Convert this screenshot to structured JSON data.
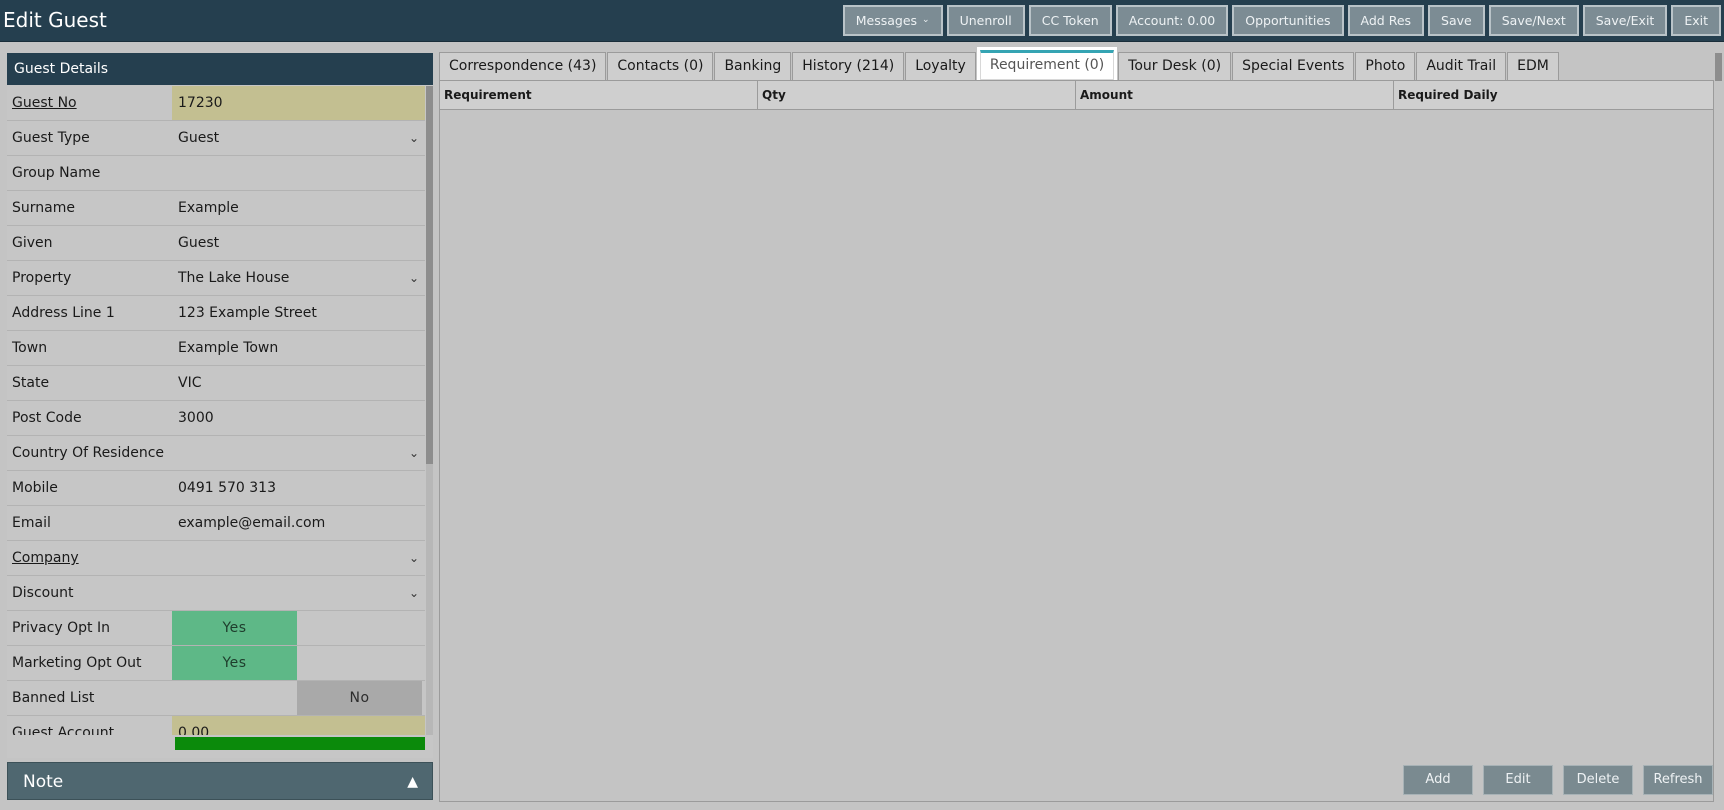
{
  "header": {
    "title": "Edit Guest",
    "toolbar": [
      {
        "name": "messages-button",
        "label": "Messages",
        "dropdown": true
      },
      {
        "name": "unenroll-button",
        "label": "Unenroll"
      },
      {
        "name": "cc-token-button",
        "label": "CC Token"
      },
      {
        "name": "account-button",
        "label": "Account: 0.00"
      },
      {
        "name": "opportunities-button",
        "label": "Opportunities"
      },
      {
        "name": "add-res-button",
        "label": "Add Res"
      },
      {
        "name": "save-button",
        "label": "Save"
      },
      {
        "name": "save-next-button",
        "label": "Save/Next"
      },
      {
        "name": "save-exit-button",
        "label": "Save/Exit"
      },
      {
        "name": "exit-button",
        "label": "Exit"
      }
    ]
  },
  "guest_details": {
    "title": "Guest Details",
    "fields": [
      {
        "label": "Guest No",
        "value": "17230",
        "link": true,
        "style": "yellow"
      },
      {
        "label": "Guest Type",
        "value": "Guest",
        "dropdown": true
      },
      {
        "label": "Group Name",
        "value": ""
      },
      {
        "label": "Surname",
        "value": "Example"
      },
      {
        "label": "Given",
        "value": "Guest"
      },
      {
        "label": "Property",
        "value": "The Lake House",
        "dropdown": true
      },
      {
        "label": "Address Line 1",
        "value": "123 Example Street"
      },
      {
        "label": "Town",
        "value": "Example Town"
      },
      {
        "label": "State",
        "value": "VIC"
      },
      {
        "label": "Post Code",
        "value": "3000"
      },
      {
        "label": "Country Of Residence",
        "value": "",
        "dropdown": true
      },
      {
        "label": "Mobile",
        "value": "0491 570 313"
      },
      {
        "label": "Email",
        "value": "example@email.com"
      },
      {
        "label": "Company",
        "value": "",
        "link": true,
        "dropdown": true
      },
      {
        "label": "Discount",
        "value": "",
        "dropdown": true
      },
      {
        "label": "Privacy Opt In",
        "value": "Yes",
        "toggle": "yes"
      },
      {
        "label": "Marketing Opt Out",
        "value": "Yes",
        "toggle": "yes"
      },
      {
        "label": "Banned List",
        "value": "No",
        "toggle": "no"
      },
      {
        "label": "Guest Account",
        "value": "0.00",
        "link": true,
        "style": "yellow"
      }
    ]
  },
  "note": {
    "title": "Note"
  },
  "tabs": [
    {
      "label": "Correspondence (43)"
    },
    {
      "label": "Contacts (0)"
    },
    {
      "label": "Banking"
    },
    {
      "label": "History (214)"
    },
    {
      "label": "Loyalty"
    },
    {
      "label": "Requirement (0)",
      "active": true
    },
    {
      "label": "Tour Desk (0)"
    },
    {
      "label": "Special Events"
    },
    {
      "label": "Photo"
    },
    {
      "label": "Audit Trail"
    },
    {
      "label": "EDM"
    }
  ],
  "requirement_grid": {
    "columns": [
      "Requirement",
      "Qty",
      "Amount",
      "Required Daily"
    ],
    "rows": []
  },
  "actions": {
    "add": "Add",
    "edit": "Edit",
    "delete": "Delete",
    "refresh": "Refresh"
  },
  "colors": {
    "header_bg": "#253f4f",
    "toggle_yes": "#5eb887",
    "toggle_no": "#a9a9a9",
    "highlight_yellow": "#c3bf91",
    "active_tab_accent": "#35a4b3"
  }
}
